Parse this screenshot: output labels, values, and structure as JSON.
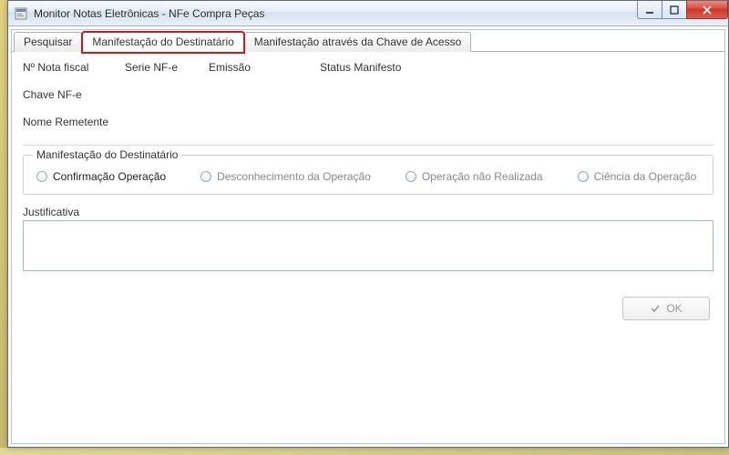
{
  "window": {
    "title": "Monitor Notas Eletrônicas - NFe Compra Peças"
  },
  "tabs": [
    {
      "label": "Pesquisar"
    },
    {
      "label": "Manifestação do Destinatário"
    },
    {
      "label": "Manifestação através da Chave de Acesso"
    }
  ],
  "header": {
    "nota_fiscal_label": "Nº Nota fiscal",
    "serie_label": "Serie NF-e",
    "emissao_label": "Emissão",
    "status_label": "Status Manifesto",
    "chave_label": "Chave NF-e",
    "remetente_label": "Nome Remetente"
  },
  "group": {
    "legend": "Manifestação do Destinatário",
    "options": [
      {
        "label": "Confirmação Operação",
        "enabled": true
      },
      {
        "label": "Desconhecimento da Operação",
        "enabled": false
      },
      {
        "label": "Operação não Realizada",
        "enabled": false
      },
      {
        "label": "Ciência da Operação",
        "enabled": false
      }
    ]
  },
  "justificativa": {
    "label": "Justificativa",
    "value": ""
  },
  "buttons": {
    "ok": "OK"
  }
}
